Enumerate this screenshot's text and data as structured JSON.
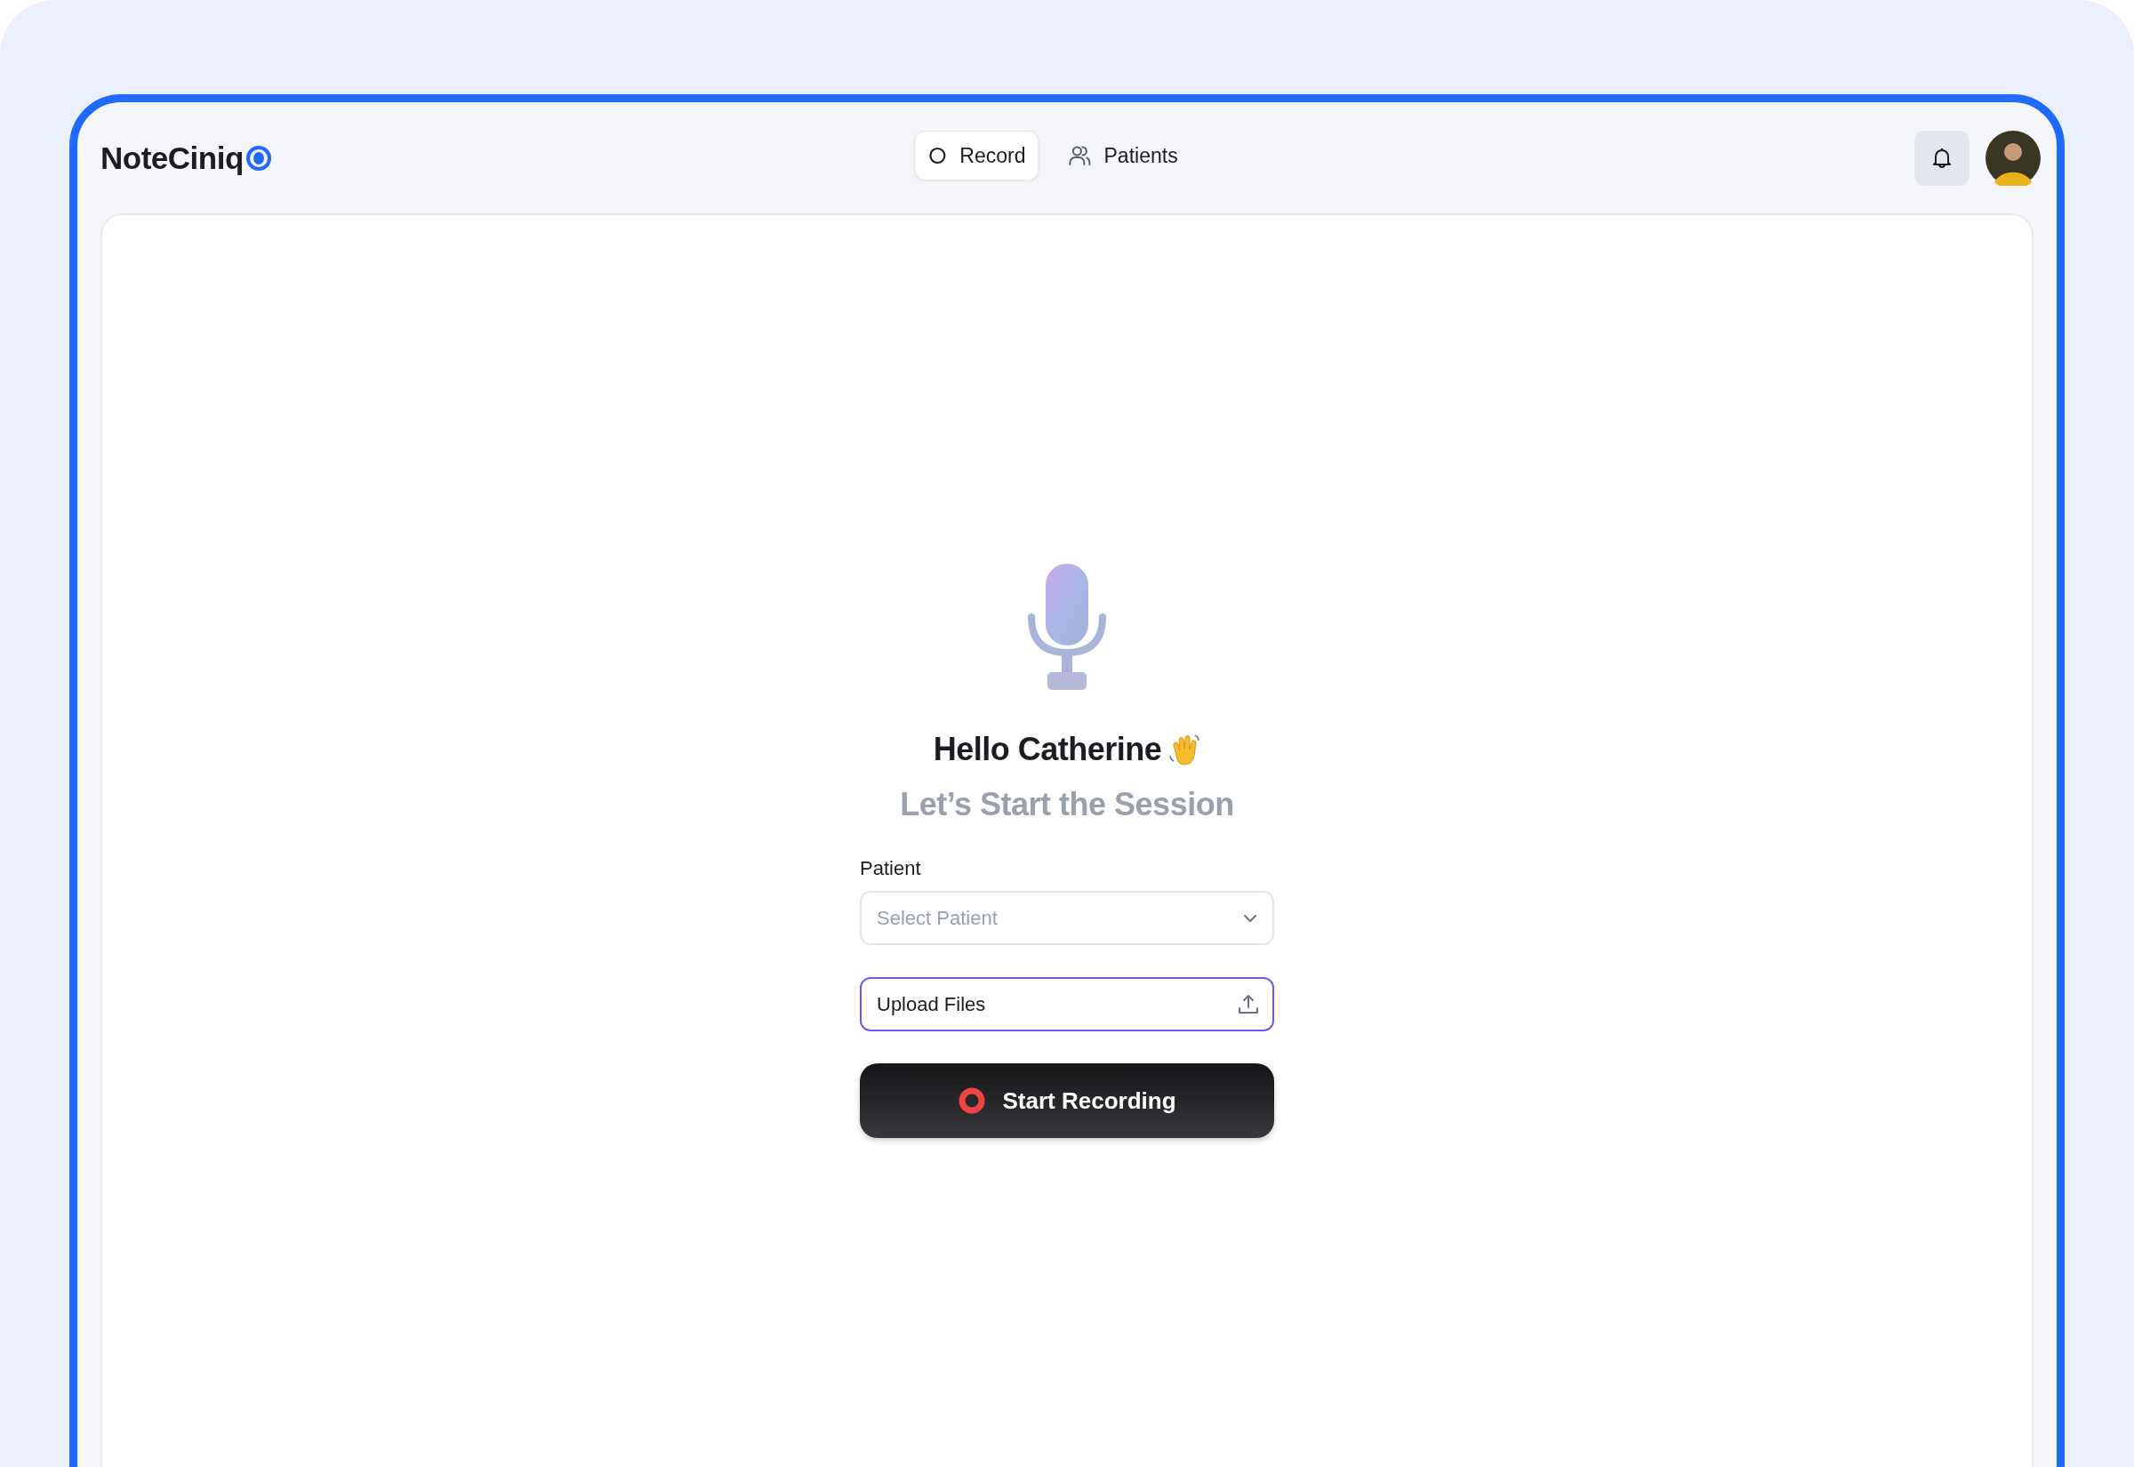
{
  "header": {
    "logo": "NoteCiniq",
    "tabs": [
      {
        "label": "Record",
        "selected": true
      },
      {
        "label": "Patients",
        "selected": false
      }
    ]
  },
  "session": {
    "greeting": "Hello Catherine",
    "subtitle": "Let’s Start the Session",
    "patient_field": {
      "label": "Patient",
      "placeholder": "Select Patient"
    },
    "upload_field": {
      "value": "Upload Files"
    },
    "start_button": {
      "label": "Start Recording"
    }
  }
}
